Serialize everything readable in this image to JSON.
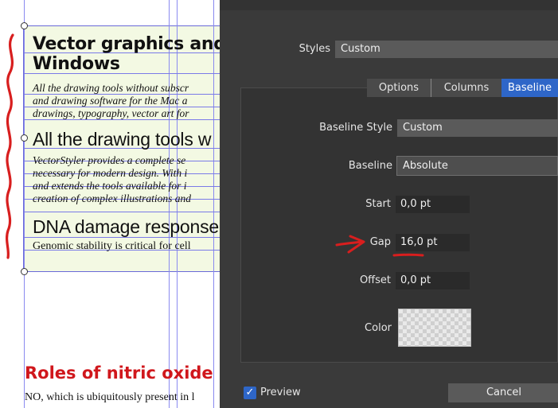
{
  "document": {
    "heading1_line1": "Vector graphics and i",
    "heading1_line2": "Windows",
    "para1_line1": "All the drawing tools without subscr",
    "para1_line2": "and drawing software for the Mac a",
    "para1_line3": "drawings, typography, vector art for",
    "heading2": "All the drawing tools w",
    "para2_line1": "VectorStyler provides a complete se",
    "para2_line2": "necessary for modern design. With i",
    "para2_line3": "and extends the tools available for i",
    "para2_line4": "creation of complex illustrations and",
    "heading3": "DNA damage response",
    "para3_line1": "Genomic stability is critical for cell",
    "heading4": "Roles of nitric oxide (M",
    "para4_line1": "NO, which is ubiquitously present in l"
  },
  "dialog": {
    "styles_label": "Styles",
    "styles_value": "Custom",
    "tabs": [
      {
        "label": "Options"
      },
      {
        "label": "Columns"
      },
      {
        "label": "Baseline"
      }
    ],
    "baseline_style_label": "Baseline Style",
    "baseline_style_value": "Custom",
    "baseline_label": "Baseline",
    "baseline_value": "Absolute",
    "start_label": "Start",
    "start_value": "0,0 pt",
    "gap_label": "Gap",
    "gap_value": "16,0 pt",
    "offset_label": "Offset",
    "offset_value": "0,0 pt",
    "color_label": "Color",
    "preview_label": "Preview",
    "preview_checked": true,
    "cancel_label": "Cancel",
    "accent_color": "#2e66c8",
    "annotation_color": "#d81e1e"
  }
}
